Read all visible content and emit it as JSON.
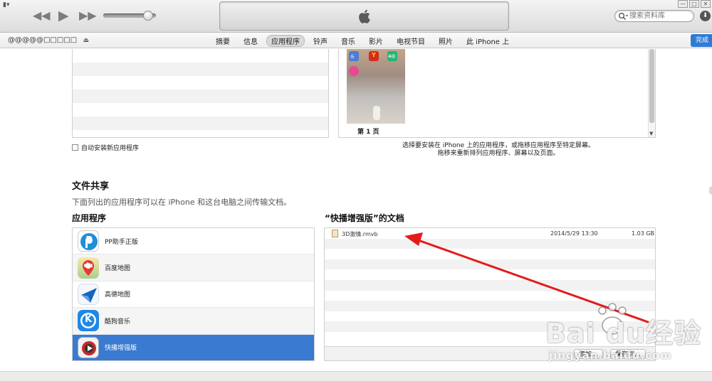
{
  "window": {
    "menu_glyph": "▮▾",
    "controls": [
      "—",
      "□",
      "✕"
    ]
  },
  "toolbar": {
    "prev_glyph": "◀◀",
    "play_glyph": "▶",
    "next_glyph": "▶▶",
    "volume_level": 0.85,
    "search_placeholder": "搜索资料库",
    "download_glyph": "⬇"
  },
  "nav": {
    "device_name": "@@@@@□□□□□",
    "eject_glyph": "⏏",
    "tabs": [
      {
        "label": "摘要"
      },
      {
        "label": "信息"
      },
      {
        "label": "应用程序"
      },
      {
        "label": "铃声"
      },
      {
        "label": "音乐"
      },
      {
        "label": "影片"
      },
      {
        "label": "电视节目"
      },
      {
        "label": "照片"
      },
      {
        "label": "此 iPhone 上"
      }
    ],
    "active_tab": "应用程序",
    "done_label": "完成"
  },
  "apps_section": {
    "page_label": "第 1 页",
    "scroll_arrow": "▼",
    "auto_install_label": "自动安装新应用程序",
    "hint_line1": "选择要安装在 iPhone 上的应用程序，或拖移应用程序至特定屏幕。",
    "hint_line2": "拖移来重新排列应用程序、屏幕以及页面。",
    "home_icon_labels": [
      "乐",
      "Y",
      "美图"
    ]
  },
  "file_sharing": {
    "title": "文件共享",
    "description": "下面列出的应用程序可以在 iPhone 和这台电脑之间传输文档。",
    "apps_header": "应用程序",
    "apps": [
      {
        "name": "PP助手正版",
        "icon": "pp-assistant-icon",
        "icon_text": "P",
        "color": "#1f8fd8"
      },
      {
        "name": "百度地图",
        "icon": "baidu-map-icon",
        "icon_text": "du",
        "color": "#e53935"
      },
      {
        "name": "高德地图",
        "icon": "amap-icon",
        "icon_text": "",
        "color": "#1565c0"
      },
      {
        "name": "酷狗音乐",
        "icon": "kugou-icon",
        "icon_text": "K",
        "color": "#1e88e5"
      },
      {
        "name": "快播增强版",
        "icon": "qvod-icon",
        "icon_text": "",
        "color": "#c62828"
      }
    ],
    "selected_app": "快播增强版",
    "docs_header": "“快播增强版”的文档",
    "docs": [
      {
        "name": "3D激情.rmvb",
        "date": "2014/5/29 13:30",
        "size": "1.03 GB"
      }
    ],
    "add_label": "添加...",
    "save_label": "保存到..."
  },
  "watermark": {
    "text": "Bai du经验",
    "url": "jingyan.baidu.com"
  },
  "colors": {
    "selection": "#3a7ad1",
    "done_button": "#2f7bd6",
    "annotation_arrow": "#e41b1b"
  }
}
